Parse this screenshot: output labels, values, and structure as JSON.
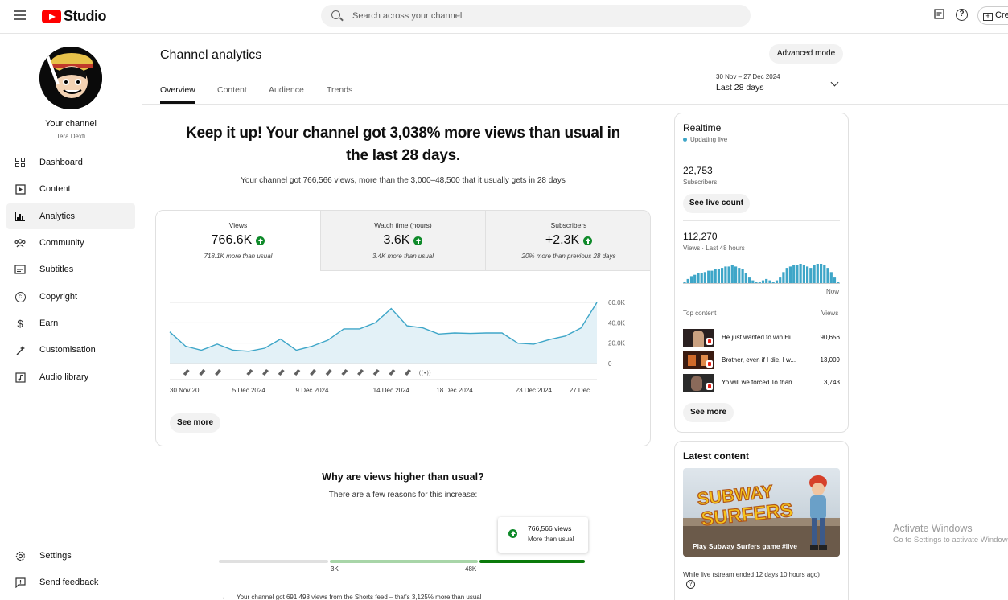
{
  "topbar": {
    "brand": "Studio",
    "search_placeholder": "Search across your channel",
    "create_label": "Create"
  },
  "sidebar": {
    "channel_title": "Your channel",
    "channel_name": "Tera Dexti",
    "items": [
      {
        "label": "Dashboard",
        "icon": "dashboard-icon"
      },
      {
        "label": "Content",
        "icon": "content-icon"
      },
      {
        "label": "Analytics",
        "icon": "analytics-icon",
        "active": true
      },
      {
        "label": "Community",
        "icon": "community-icon"
      },
      {
        "label": "Subtitles",
        "icon": "subtitles-icon"
      },
      {
        "label": "Copyright",
        "icon": "copyright-icon"
      },
      {
        "label": "Earn",
        "icon": "earn-icon"
      },
      {
        "label": "Customisation",
        "icon": "customisation-icon"
      },
      {
        "label": "Audio library",
        "icon": "audio-library-icon"
      }
    ],
    "bottom": [
      {
        "label": "Settings",
        "icon": "gear-icon"
      },
      {
        "label": "Send feedback",
        "icon": "feedback-icon"
      }
    ]
  },
  "header": {
    "title": "Channel analytics",
    "advanced_mode": "Advanced mode",
    "tabs": [
      "Overview",
      "Content",
      "Audience",
      "Trends"
    ],
    "date_range": "30 Nov – 27 Dec 2024",
    "period": "Last 28 days"
  },
  "overview": {
    "headline": "Keep it up! Your channel got 3,038% more views than usual in the last 28 days.",
    "subline": "Your channel got 766,566 views, more than the 3,000–48,500 that it usually gets in 28 days",
    "metrics": [
      {
        "label": "Views",
        "value": "766.6K",
        "compare": "718.1K more than usual"
      },
      {
        "label": "Watch time (hours)",
        "value": "3.6K",
        "compare": "3.4K more than usual"
      },
      {
        "label": "Subscribers",
        "value": "+2.3K",
        "compare": "20% more than previous 28 days"
      }
    ],
    "see_more": "See more"
  },
  "chart_data": {
    "type": "area",
    "x": [
      "30 Nov",
      "1 Dec",
      "2 Dec",
      "3 Dec",
      "4 Dec",
      "5 Dec",
      "6 Dec",
      "7 Dec",
      "8 Dec",
      "9 Dec",
      "10 Dec",
      "11 Dec",
      "12 Dec",
      "13 Dec",
      "14 Dec",
      "15 Dec",
      "16 Dec",
      "17 Dec",
      "18 Dec",
      "19 Dec",
      "20 Dec",
      "21 Dec",
      "22 Dec",
      "23 Dec",
      "24 Dec",
      "25 Dec",
      "26 Dec",
      "27 Dec"
    ],
    "x_tick_labels": [
      "30 Nov 20...",
      "5 Dec 2024",
      "9 Dec 2024",
      "14 Dec 2024",
      "18 Dec 2024",
      "23 Dec 2024",
      "27 Dec ..."
    ],
    "series": [
      {
        "values": [
          31000,
          17000,
          13000,
          19000,
          13000,
          12000,
          15000,
          24000,
          13000,
          17000,
          23000,
          34000,
          34000,
          40000,
          54000,
          37000,
          35000,
          29000,
          30000,
          29500,
          30000,
          30000,
          20000,
          19000,
          23500,
          27000,
          35000,
          60000
        ]
      }
    ],
    "ylim": [
      0,
      60000
    ],
    "y_tick_labels": [
      "0",
      "20.0K",
      "40.0K",
      "60.0K"
    ],
    "short_marker_days": [
      1,
      2,
      3,
      5,
      6,
      7,
      8,
      9,
      10,
      11,
      12,
      13,
      14,
      15
    ],
    "live_marker_day": 16,
    "colors": {
      "line": "#3ea6c8",
      "fill": "#e3f1f7"
    }
  },
  "why": {
    "title": "Why are views higher than usual?",
    "subtitle": "There are a few reasons for this increase:",
    "tooltip_value": "766,566 views",
    "tooltip_note": "More than usual",
    "range_low": "3K",
    "range_high": "48K",
    "reason": "Your channel got 691,498 views from the Shorts feed – that's 3,125% more than usual"
  },
  "realtime": {
    "title": "Realtime",
    "status": "Updating live",
    "subscribers": "22,753",
    "subscribers_label": "Subscribers",
    "live_count_button": "See live count",
    "views": "112,270",
    "views_label": "Views · Last 48 hours",
    "now_label": "Now",
    "bars": [
      1,
      3,
      5,
      6,
      7,
      7,
      8,
      9,
      9,
      10,
      10,
      11,
      12,
      12,
      13,
      12,
      11,
      10,
      7,
      4,
      2,
      1,
      1,
      2,
      3,
      2,
      1,
      2,
      4,
      8,
      11,
      12,
      13,
      13,
      14,
      13,
      12,
      11,
      13,
      14,
      14,
      13,
      11,
      8,
      4,
      1
    ],
    "top_content_label": "Top content",
    "views_header": "Views",
    "top_content": [
      {
        "title": "He just wanted to win Hi...",
        "views": "90,656"
      },
      {
        "title": "Brother, even if I die, I w...",
        "views": "13,009"
      },
      {
        "title": "Yo will we forced To than...",
        "views": "3,743"
      }
    ],
    "see_more": "See more"
  },
  "latest": {
    "title": "Latest content",
    "video_title": "Play Subway Surfers game #live",
    "game_logo": "SUBWAY SURFERS",
    "meta": "While live (stream ended 12 days 10 hours ago)"
  },
  "watermark": {
    "line1": "Activate Windows",
    "line2": "Go to Settings to activate Windows."
  }
}
